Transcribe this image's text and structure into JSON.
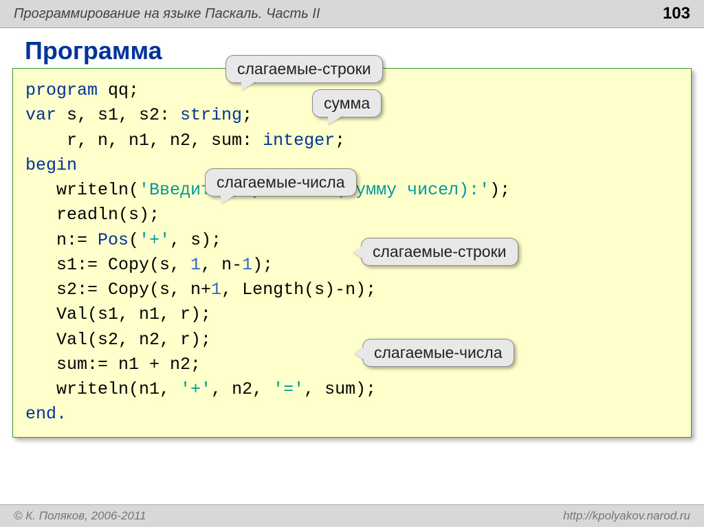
{
  "header": {
    "subject": "Программирование на языке Паскаль. Часть II",
    "page_number": "103"
  },
  "title": "Программа",
  "callouts": {
    "c1": "слагаемые-строки",
    "c2": "сумма",
    "c3": "слагаемые-числа",
    "c4": "слагаемые-строки",
    "c5": "слагаемые-числа"
  },
  "code": {
    "l01a": "program",
    "l01b": " qq;",
    "l02a": "var",
    "l02b": " s, s1, s2: ",
    "l02c": "string",
    "l02d": ";",
    "l03a": "    r, n, n1, n2, sum: ",
    "l03b": "integer",
    "l03c": ";",
    "l04a": "begin",
    "l05a": "   writeln(",
    "l05b": "'Введите выражение (сумму чисел):'",
    "l05c": ");",
    "l06a": "   readln(s);",
    "l07a": "   n:= ",
    "l07b": "Pos",
    "l07c": "(",
    "l07d": "'+'",
    "l07e": ", s);",
    "l08a": "   s1:= Copy(s, ",
    "l08b": "1",
    "l08c": ", n-",
    "l08d": "1",
    "l08e": ");",
    "l09a": "   s2:= Copy(s, n+",
    "l09b": "1",
    "l09c": ", Length(s)-n);",
    "l10a": "   Val(s1, n1, r);",
    "l11a": "   Val(s2, n2, r);",
    "l12a": "   sum:= n1 + n2;",
    "l13a": "   writeln(n1, ",
    "l13b": "'+'",
    "l13c": ", n2, ",
    "l13d": "'='",
    "l13e": ", sum);",
    "l14a": "end."
  },
  "footer": {
    "copyright": "© К. Поляков, 2006-2011",
    "url": "http://kpolyakov.narod.ru"
  }
}
